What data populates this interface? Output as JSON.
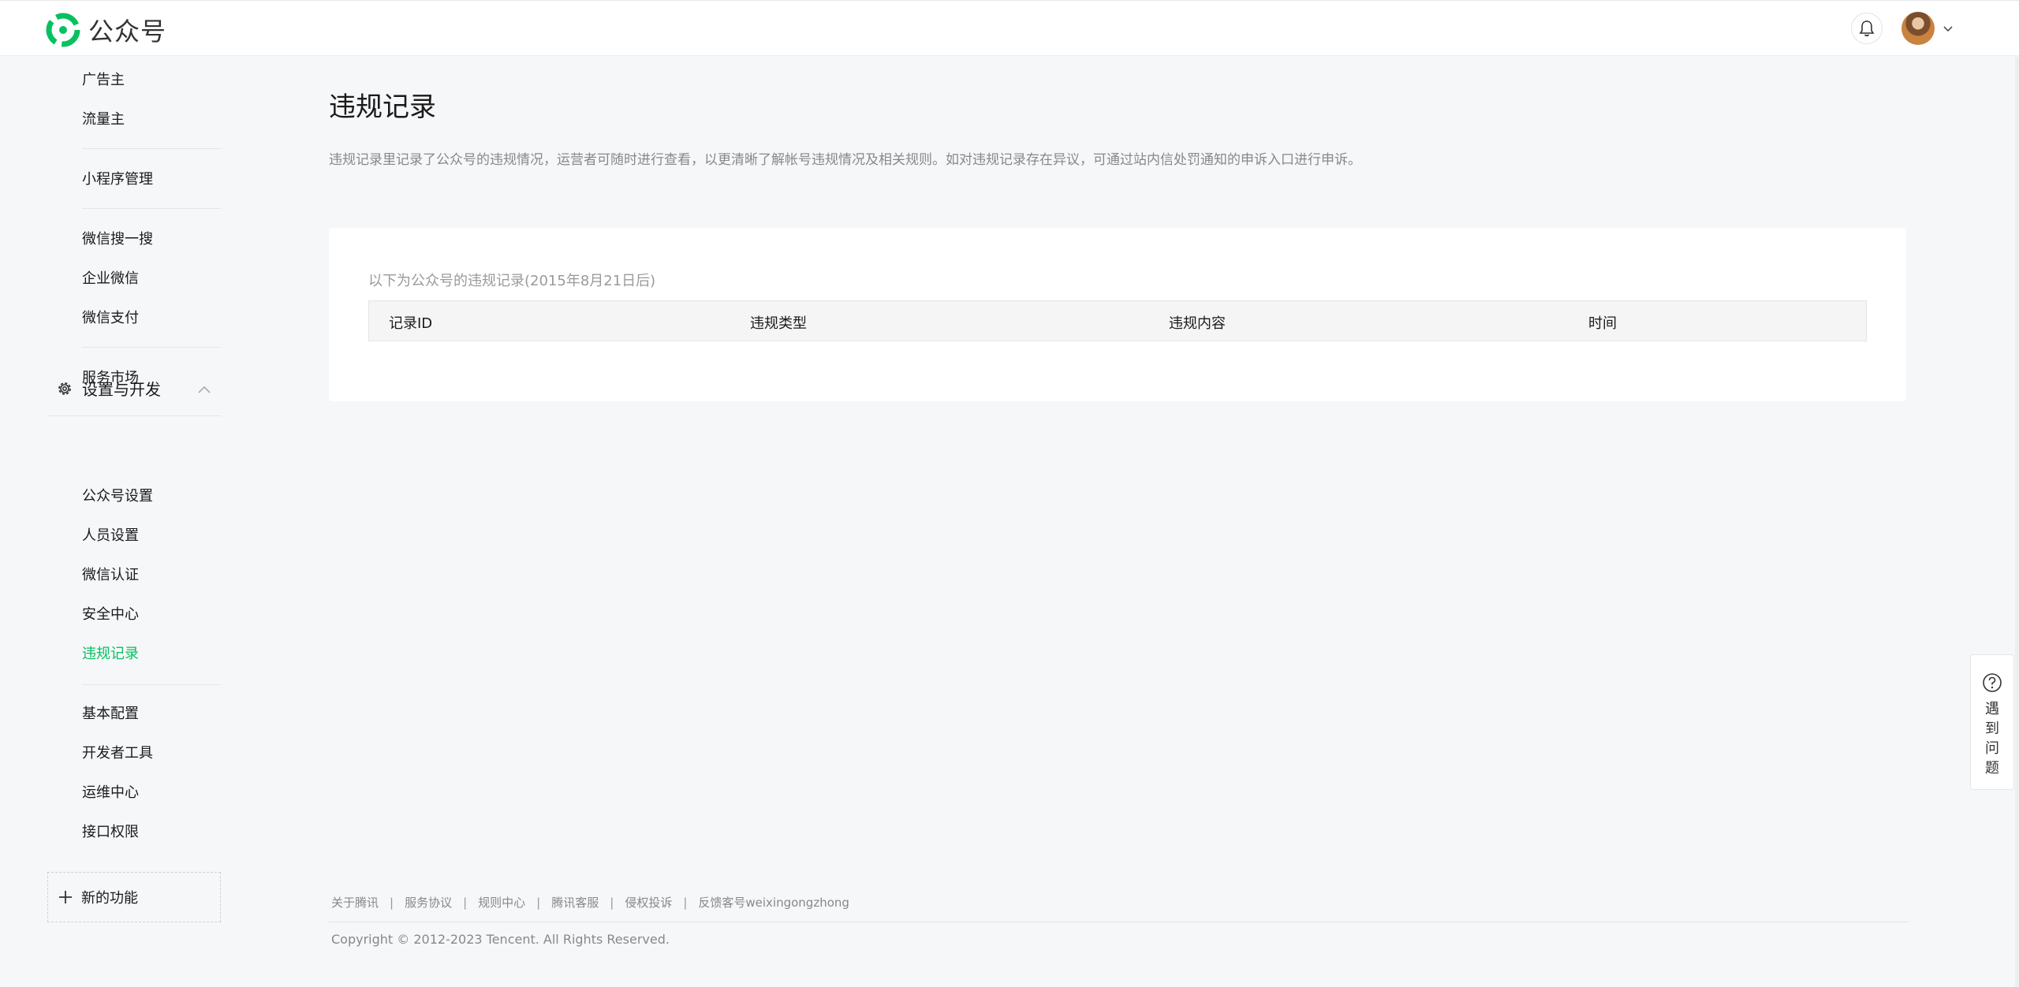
{
  "header": {
    "brand": "公众号",
    "brand_color": "#07c160",
    "icons": {
      "bell": "bell-icon",
      "avatar": "user-avatar",
      "caret": "chevron-down-icon"
    }
  },
  "sidebar": {
    "group1": [
      "广告主",
      "流量主"
    ],
    "group2": [
      "小程序管理"
    ],
    "group3": [
      "微信搜一搜",
      "企业微信",
      "微信支付"
    ],
    "group4": [
      "服务市场"
    ],
    "section": {
      "label": "设置与开发",
      "icon": "gear-icon",
      "expanded": true
    },
    "group5": [
      "公众号设置",
      "人员设置",
      "微信认证",
      "安全中心",
      "违规记录"
    ],
    "active_item": "违规记录",
    "group6": [
      "基本配置",
      "开发者工具",
      "运维中心",
      "接口权限"
    ],
    "new_feature": "新的功能"
  },
  "main": {
    "title": "违规记录",
    "description": "违规记录里记录了公众号的违规情况，运营者可随时进行查看，以更清晰了解帐号违规情况及相关规则。如对违规记录存在异议，可通过站内信处罚通知的申诉入口进行申诉。",
    "caption": "以下为公众号的违规记录(2015年8月21日后)",
    "table": {
      "columns": [
        "记录ID",
        "违规类型",
        "违规内容",
        "时间"
      ],
      "rows": []
    }
  },
  "footer": {
    "links": [
      "关于腾讯",
      "服务协议",
      "规则中心",
      "腾讯客服",
      "侵权投诉",
      "反馈客号weixingongzhong"
    ],
    "copyright": "Copyright © 2012-2023 Tencent. All Rights Reserved."
  },
  "help_float": {
    "label": "遇到问题",
    "chars": [
      "遇",
      "到",
      "问",
      "题"
    ],
    "icon": "help-circle-icon"
  }
}
